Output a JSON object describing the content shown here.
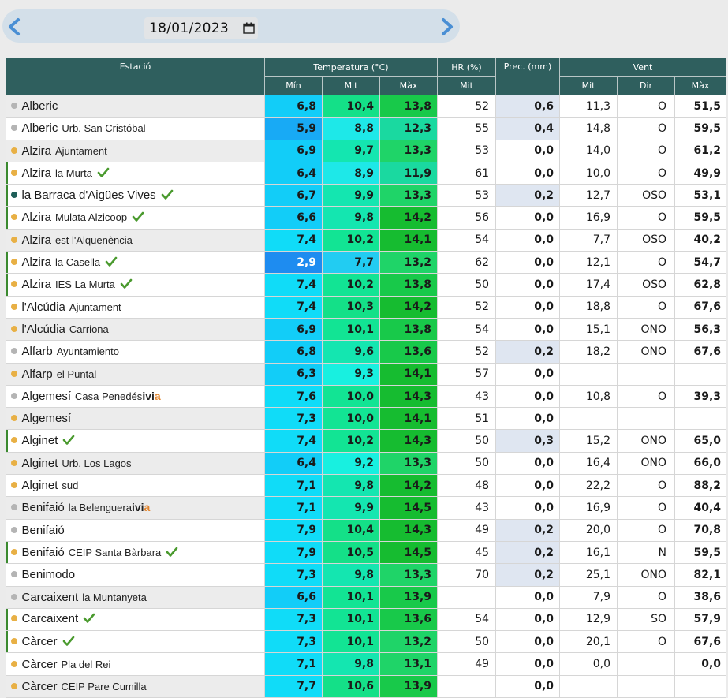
{
  "date": {
    "value": "18/01/2023"
  },
  "table": {
    "headers": {
      "estacio": "Estació",
      "temperatura": "Temperatura (°C)",
      "hr": "HR (%)",
      "prec": "Prec. (mm)",
      "vent": "Vent",
      "min": "Mín",
      "mit": "Mit",
      "max": "Màx",
      "hr_mit": "Mit",
      "vent_mit": "Mit",
      "vent_dir": "Dir",
      "vent_max": "Màx"
    },
    "rows": [
      {
        "name": "Alberic",
        "sub": "",
        "ivia": false,
        "check": false,
        "dot": "#b4b4b4",
        "min": "6,8",
        "mit": "10,4",
        "max": "13,8",
        "hr": "52",
        "prec": "0,6",
        "vmit": "11,3",
        "dir": "O",
        "vmax": "51,5"
      },
      {
        "name": "Alberic",
        "sub": "Urb. San Cristóbal",
        "ivia": false,
        "check": false,
        "dot": "#b4b4b4",
        "min": "5,9",
        "mit": "8,8",
        "max": "12,3",
        "hr": "55",
        "prec": "0,4",
        "vmit": "14,8",
        "dir": "O",
        "vmax": "59,5"
      },
      {
        "name": "Alzira",
        "sub": "Ajuntament",
        "ivia": false,
        "check": false,
        "dot": "#e8b045",
        "min": "6,9",
        "mit": "9,7",
        "max": "13,3",
        "hr": "53",
        "prec": "0,0",
        "vmit": "14,0",
        "dir": "O",
        "vmax": "61,2"
      },
      {
        "name": "Alzira",
        "sub": "la Murta",
        "ivia": false,
        "check": true,
        "dot": "#e8b045",
        "min": "6,4",
        "mit": "8,9",
        "max": "11,9",
        "hr": "61",
        "prec": "0,0",
        "vmit": "10,0",
        "dir": "O",
        "vmax": "49,9"
      },
      {
        "name": "la Barraca d'Aigües Vives",
        "sub": "",
        "ivia": false,
        "check": true,
        "dot": "#1e5e58",
        "min": "6,7",
        "mit": "9,9",
        "max": "13,3",
        "hr": "53",
        "prec": "0,2",
        "vmit": "12,7",
        "dir": "OSO",
        "vmax": "53,1"
      },
      {
        "name": "Alzira",
        "sub": "Mulata Alzicoop",
        "ivia": false,
        "check": true,
        "dot": "#e8b045",
        "min": "6,6",
        "mit": "9,8",
        "max": "14,2",
        "hr": "56",
        "prec": "0,0",
        "vmit": "16,9",
        "dir": "O",
        "vmax": "59,5"
      },
      {
        "name": "Alzira",
        "sub": "est l'Alquenència",
        "ivia": false,
        "check": false,
        "dot": "#e8b045",
        "min": "7,4",
        "mit": "10,2",
        "max": "14,1",
        "hr": "54",
        "prec": "0,0",
        "vmit": "7,7",
        "dir": "OSO",
        "vmax": "40,2"
      },
      {
        "name": "Alzira",
        "sub": "la Casella",
        "ivia": false,
        "check": true,
        "dot": "#e8b045",
        "min": "2,9",
        "mit": "7,7",
        "max": "13,2",
        "hr": "62",
        "prec": "0,0",
        "vmit": "12,1",
        "dir": "O",
        "vmax": "54,7"
      },
      {
        "name": "Alzira",
        "sub": "IES La Murta",
        "ivia": false,
        "check": true,
        "dot": "#e8b045",
        "min": "7,4",
        "mit": "10,2",
        "max": "13,8",
        "hr": "50",
        "prec": "0,0",
        "vmit": "17,4",
        "dir": "OSO",
        "vmax": "62,8"
      },
      {
        "name": "l'Alcúdia",
        "sub": "Ajuntament",
        "ivia": false,
        "check": false,
        "dot": "#e8b045",
        "min": "7,4",
        "mit": "10,3",
        "max": "14,2",
        "hr": "52",
        "prec": "0,0",
        "vmit": "18,8",
        "dir": "O",
        "vmax": "67,6"
      },
      {
        "name": "l'Alcúdia",
        "sub": "Carriona",
        "ivia": false,
        "check": false,
        "dot": "#e8b045",
        "min": "6,9",
        "mit": "10,1",
        "max": "13,8",
        "hr": "54",
        "prec": "0,0",
        "vmit": "15,1",
        "dir": "ONO",
        "vmax": "56,3"
      },
      {
        "name": "Alfarb",
        "sub": "Ayuntamiento",
        "ivia": false,
        "check": false,
        "dot": "#b4b4b4",
        "min": "6,8",
        "mit": "9,6",
        "max": "13,6",
        "hr": "52",
        "prec": "0,2",
        "vmit": "18,2",
        "dir": "ONO",
        "vmax": "67,6"
      },
      {
        "name": "Alfarp",
        "sub": "el Puntal",
        "ivia": false,
        "check": false,
        "dot": "#e8b045",
        "min": "6,3",
        "mit": "9,3",
        "max": "14,1",
        "hr": "57",
        "prec": "0,0",
        "vmit": "",
        "dir": "",
        "vmax": ""
      },
      {
        "name": "Algemesí",
        "sub": "Casa Penedés",
        "ivia": true,
        "check": false,
        "dot": "#b4b4b4",
        "min": "7,6",
        "mit": "10,0",
        "max": "14,3",
        "hr": "43",
        "prec": "0,0",
        "vmit": "10,8",
        "dir": "O",
        "vmax": "39,3"
      },
      {
        "name": "Algemesí",
        "sub": "",
        "ivia": false,
        "check": false,
        "dot": "#e8b045",
        "min": "7,3",
        "mit": "10,0",
        "max": "14,1",
        "hr": "51",
        "prec": "0,0",
        "vmit": "",
        "dir": "",
        "vmax": ""
      },
      {
        "name": "Alginet",
        "sub": "",
        "ivia": false,
        "check": true,
        "dot": "#e8b045",
        "min": "7,4",
        "mit": "10,2",
        "max": "14,3",
        "hr": "50",
        "prec": "0,3",
        "vmit": "15,2",
        "dir": "ONO",
        "vmax": "65,0"
      },
      {
        "name": "Alginet",
        "sub": "Urb. Los Lagos",
        "ivia": false,
        "check": false,
        "dot": "#e8b045",
        "min": "6,4",
        "mit": "9,2",
        "max": "13,3",
        "hr": "50",
        "prec": "0,0",
        "vmit": "16,4",
        "dir": "ONO",
        "vmax": "66,0"
      },
      {
        "name": "Alginet",
        "sub": "sud",
        "ivia": false,
        "check": false,
        "dot": "#e8b045",
        "min": "7,1",
        "mit": "9,8",
        "max": "14,2",
        "hr": "48",
        "prec": "0,0",
        "vmit": "22,2",
        "dir": "O",
        "vmax": "88,2"
      },
      {
        "name": "Benifaió",
        "sub": "la Belenguera",
        "ivia": true,
        "check": false,
        "dot": "#b4b4b4",
        "min": "7,1",
        "mit": "9,9",
        "max": "14,5",
        "hr": "43",
        "prec": "0,0",
        "vmit": "16,9",
        "dir": "O",
        "vmax": "40,4"
      },
      {
        "name": "Benifaió",
        "sub": "",
        "ivia": false,
        "check": false,
        "dot": "#b4b4b4",
        "min": "7,9",
        "mit": "10,4",
        "max": "14,3",
        "hr": "49",
        "prec": "0,2",
        "vmit": "20,0",
        "dir": "O",
        "vmax": "70,8"
      },
      {
        "name": "Benifaió",
        "sub": "CEIP Santa Bàrbara",
        "ivia": false,
        "check": true,
        "dot": "#e8b045",
        "min": "7,9",
        "mit": "10,5",
        "max": "14,5",
        "hr": "45",
        "prec": "0,2",
        "vmit": "16,1",
        "dir": "N",
        "vmax": "59,5"
      },
      {
        "name": "Benimodo",
        "sub": "",
        "ivia": false,
        "check": false,
        "dot": "#b4b4b4",
        "min": "7,3",
        "mit": "9,8",
        "max": "13,3",
        "hr": "70",
        "prec": "0,2",
        "vmit": "25,1",
        "dir": "ONO",
        "vmax": "82,1"
      },
      {
        "name": "Carcaixent",
        "sub": "la Muntanyeta",
        "ivia": false,
        "check": false,
        "dot": "#b4b4b4",
        "min": "6,6",
        "mit": "10,1",
        "max": "13,9",
        "hr": "",
        "prec": "0,0",
        "vmit": "7,9",
        "dir": "O",
        "vmax": "38,6"
      },
      {
        "name": "Carcaixent",
        "sub": "",
        "ivia": false,
        "check": true,
        "dot": "#e8b045",
        "min": "7,3",
        "mit": "10,1",
        "max": "13,6",
        "hr": "54",
        "prec": "0,0",
        "vmit": "12,9",
        "dir": "SO",
        "vmax": "57,9"
      },
      {
        "name": "Càrcer",
        "sub": "",
        "ivia": false,
        "check": true,
        "dot": "#e8b045",
        "min": "7,3",
        "mit": "10,1",
        "max": "13,2",
        "hr": "50",
        "prec": "0,0",
        "vmit": "20,1",
        "dir": "O",
        "vmax": "67,6"
      },
      {
        "name": "Càrcer",
        "sub": "Pla del Rei",
        "ivia": false,
        "check": false,
        "dot": "#e8b045",
        "min": "7,1",
        "mit": "9,8",
        "max": "13,1",
        "hr": "49",
        "prec": "0,0",
        "vmit": "0,0",
        "dir": "",
        "vmax": "0,0"
      },
      {
        "name": "Càrcer",
        "sub": "CEIP Pare Cumilla",
        "ivia": false,
        "check": false,
        "dot": "#e8b045",
        "min": "7,7",
        "mit": "10,6",
        "max": "13,9",
        "hr": "",
        "prec": "0,0",
        "vmit": "",
        "dir": "",
        "vmax": ""
      }
    ]
  },
  "labels": {
    "ivia_prefix": "ivi",
    "ivia_suffix": "a"
  },
  "icons": {
    "prev": "chevron-left-icon",
    "next": "chevron-right-icon",
    "calendar": "calendar-icon",
    "check": "check-icon"
  },
  "colors": {
    "header_bg": "#2f5f5e",
    "date_bar_bg": "#d3dfe9",
    "chevron": "#4a8fd4",
    "check": "#4a9a2e",
    "dot_grey": "#b4b4b4",
    "dot_orange": "#e8b045",
    "dot_teal": "#1e5e58",
    "prec_wet": "#dfe6f1"
  }
}
